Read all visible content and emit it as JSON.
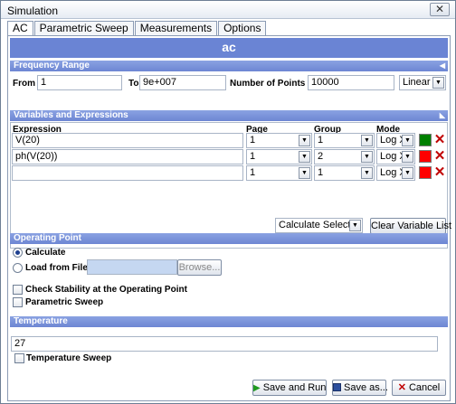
{
  "window": {
    "title": "Simulation",
    "close_glyph": "✕"
  },
  "tabs": [
    {
      "label": "AC",
      "active": true
    },
    {
      "label": "Parametric Sweep",
      "active": false
    },
    {
      "label": "Measurements",
      "active": false
    },
    {
      "label": "Options",
      "active": false
    }
  ],
  "banner": {
    "title": "ac"
  },
  "frequency": {
    "header": "Frequency Range",
    "from_label": "From",
    "from_value": "1",
    "to_label": "To",
    "to_value": "9e+007",
    "points_label": "Number of Points",
    "points_value": "10000",
    "scale": "Linear"
  },
  "variables": {
    "header": "Variables and Expressions",
    "columns": {
      "expression": "Expression",
      "page": "Page",
      "group": "Group",
      "mode": "Mode"
    },
    "rows": [
      {
        "expression": "V(20)",
        "page": "1",
        "group": "1",
        "mode": "Log X",
        "color": "#008000"
      },
      {
        "expression": "ph(V(20))",
        "page": "1",
        "group": "2",
        "mode": "Log X",
        "color": "#ff0000"
      },
      {
        "expression": "",
        "page": "1",
        "group": "1",
        "mode": "Log X",
        "color": "#ff0000"
      }
    ],
    "calculate_select": "Calculate Selected",
    "clear_button": "Clear Variable List"
  },
  "operating_point": {
    "header": "Operating Point",
    "calculate_label": "Calculate",
    "calculate_checked": true,
    "load_label": "Load from File",
    "browse_button": "Browse...",
    "stability_label": "Check Stability at the Operating Point",
    "param_sweep_label": "Parametric Sweep"
  },
  "temperature": {
    "header": "Temperature",
    "value": "27",
    "sweep_label": "Temperature Sweep"
  },
  "footer": {
    "save_run": "Save and Run",
    "save_as": "Save as...",
    "cancel": "Cancel"
  },
  "icons": {
    "dropdown": "▼",
    "collapse": "◀",
    "expand": "◣",
    "delete": "✕",
    "run": "▶"
  }
}
